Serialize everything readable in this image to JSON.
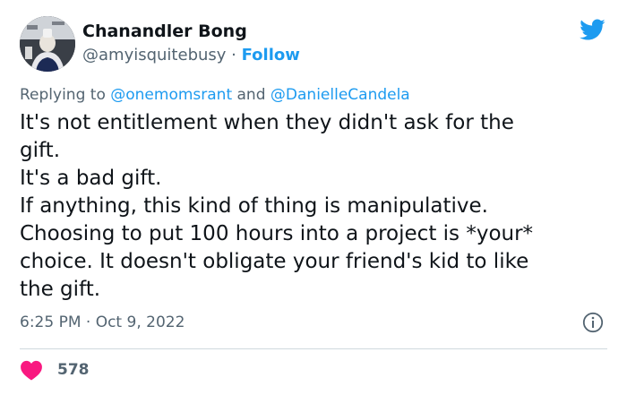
{
  "author": {
    "name": "Chanandler Bong",
    "handle": "@amyisquitebusy",
    "separator": " · ",
    "follow_label": "Follow"
  },
  "reply": {
    "prefix": "Replying to ",
    "mention1": "@onemomsrant",
    "conjunction": " and ",
    "mention2": "@DanielleCandela"
  },
  "body_lines": [
    "It's not entitlement when they didn't ask for the",
    "gift.",
    "It's a bad gift.",
    "If anything, this kind of thing is manipulative.",
    "Choosing to put 100 hours into a project is *your*",
    "choice. It doesn't obligate your friend's kid to like",
    "the gift."
  ],
  "meta": {
    "timestamp": "6:25 PM · Oct 9, 2022"
  },
  "engagement": {
    "likes": "578"
  },
  "colors": {
    "accent": "#1d9bf0",
    "heart": "#f91880",
    "secondary_text": "#536471"
  },
  "icons": {
    "brand": "twitter-bird-icon",
    "info": "info-icon",
    "like": "heart-icon"
  }
}
